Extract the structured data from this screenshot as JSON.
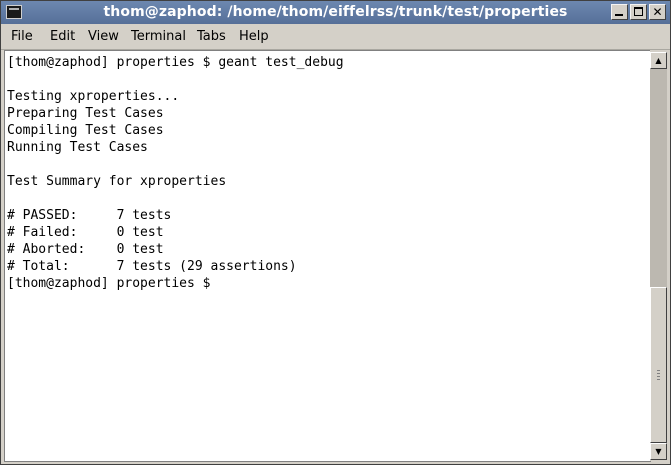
{
  "window": {
    "title": "thom@zaphod: /home/thom/eiffelrss/trunk/test/properties",
    "controls": {
      "minimize": "",
      "maximize": "",
      "close": "✕"
    }
  },
  "menu": [
    "File",
    "Edit",
    "View",
    "Terminal",
    "Tabs",
    "Help"
  ],
  "terminal": {
    "lines": [
      "[thom@zaphod] properties $ geant test_debug",
      "",
      "Testing xproperties...",
      "Preparing Test Cases",
      "Compiling Test Cases",
      "Running Test Cases",
      "",
      "Test Summary for xproperties",
      "",
      "# PASSED:     7 tests",
      "# Failed:     0 test",
      "# Aborted:    0 test",
      "# Total:      7 tests (29 assertions)",
      "[thom@zaphod] properties $"
    ]
  },
  "scrollbar": {
    "up": "▲",
    "down": "▼"
  }
}
